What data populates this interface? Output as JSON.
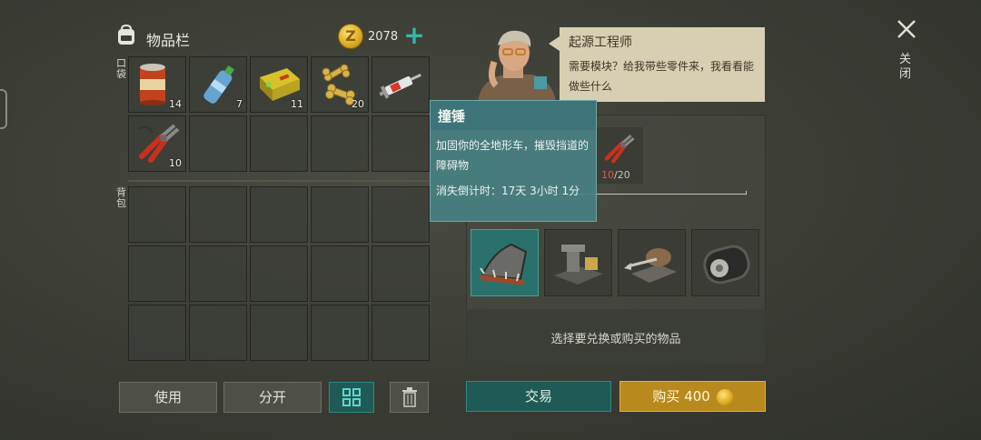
{
  "inventory": {
    "title": "物品栏",
    "coins": "2078",
    "pocket_label": "口袋",
    "backpack_label": "背包",
    "pocket_items": [
      {
        "name": "canned-food",
        "qty": "14"
      },
      {
        "name": "water-bottle",
        "qty": "7"
      },
      {
        "name": "battery",
        "qty": "11"
      },
      {
        "name": "dog-bones",
        "qty": "20"
      },
      {
        "name": "syringe",
        "qty": ""
      },
      {
        "name": "pliers",
        "qty": "10"
      }
    ]
  },
  "buttons": {
    "use": "使用",
    "split": "分开",
    "trade": "交易",
    "buy": "购买",
    "buy_price": "400"
  },
  "npc": {
    "name": "起源工程师",
    "dialog": "需要模块？给我带些零件来，我看看能做些什么"
  },
  "trade": {
    "required_have": "10",
    "required_need": "/20",
    "choose_hint": "选择要兑换或购买的物品",
    "upgrades": [
      "ram-bumper",
      "vise",
      "harpoon",
      "tracks"
    ]
  },
  "tooltip": {
    "title": "撞锤",
    "description": "加固你的全地形车，摧毁挡道的障碍物",
    "timer": "消失倒计时：17天 3小时 1分"
  },
  "close_label": "关闭",
  "colors": {
    "accent_teal": "#35b7a8",
    "gold": "#b88a1e",
    "alert_red": "#e25a48"
  }
}
